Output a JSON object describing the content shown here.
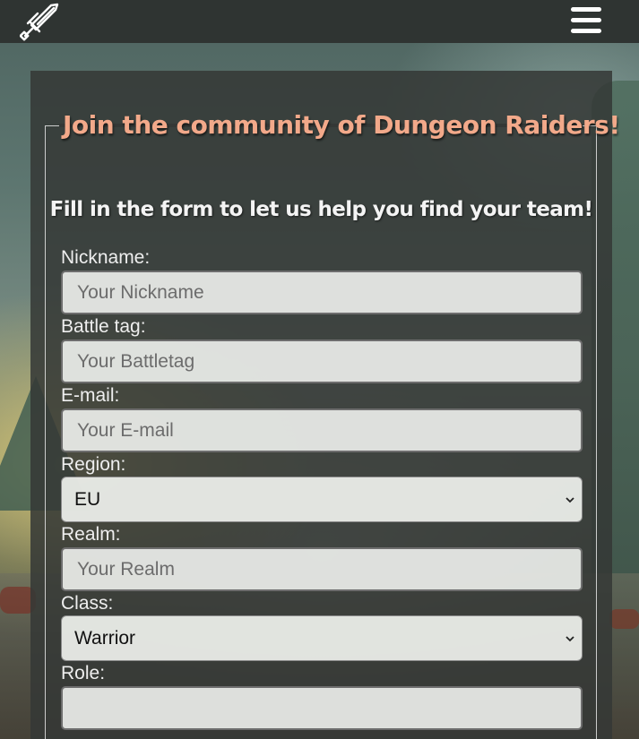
{
  "navbar": {
    "logo_icon": "crossed-sword-icon",
    "menu_icon": "hamburger-menu-icon"
  },
  "form": {
    "legend": "Join the community of Dungeon Raiders!",
    "subtitle": "Fill in the form to let us help you find your team!",
    "fields": {
      "nickname": {
        "label": "Nickname:",
        "placeholder": "Your Nickname",
        "value": ""
      },
      "battletag": {
        "label": "Battle tag:",
        "placeholder": "Your Battletag",
        "value": ""
      },
      "email": {
        "label": "E-mail:",
        "placeholder": "Your E-mail",
        "value": ""
      },
      "region": {
        "label": "Region:",
        "selected": "EU"
      },
      "realm": {
        "label": "Realm:",
        "placeholder": "Your Realm",
        "value": ""
      },
      "class": {
        "label": "Class:",
        "selected": "Warrior"
      },
      "role": {
        "label": "Role:",
        "value": ""
      }
    }
  },
  "colors": {
    "navbar": "#2f3432",
    "legend_text": "#f2a98a",
    "panel": "#343836"
  }
}
